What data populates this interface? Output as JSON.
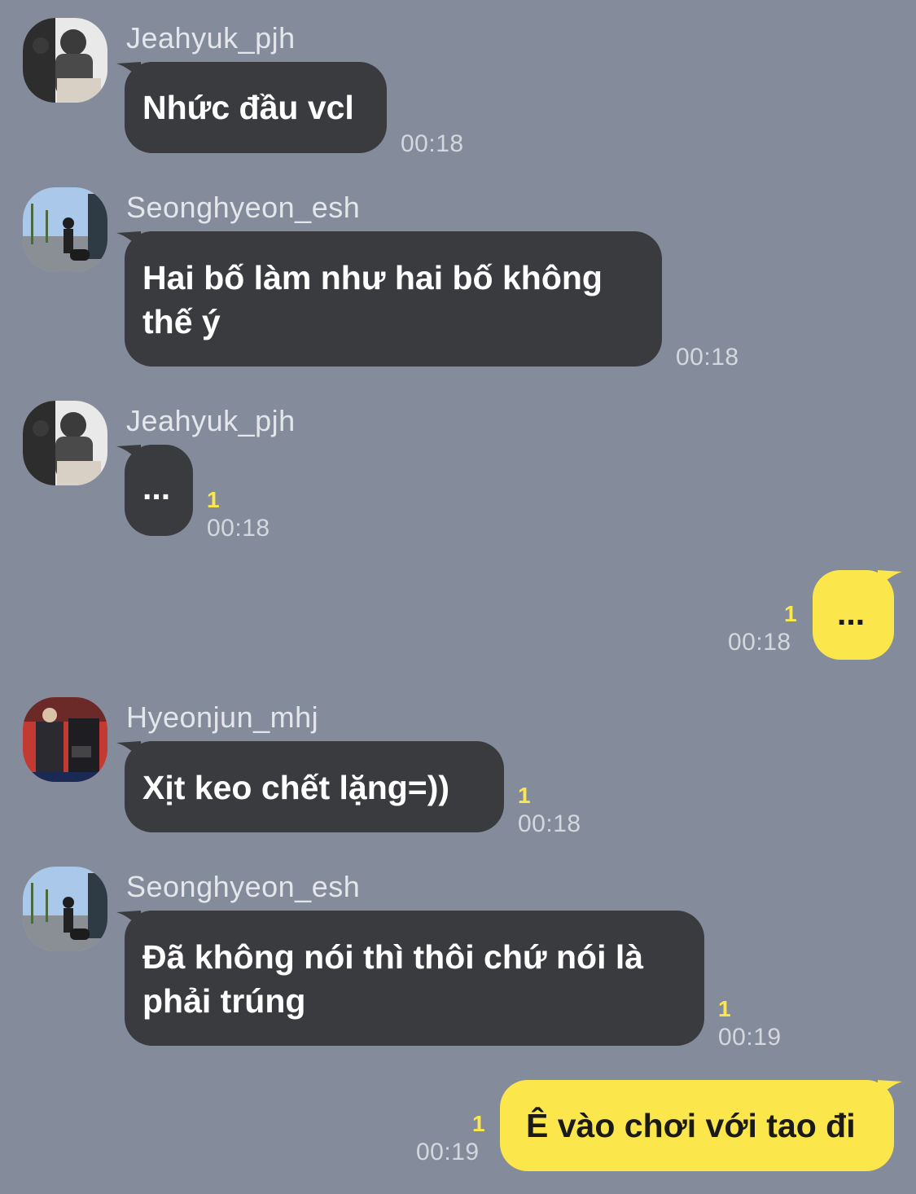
{
  "colors": {
    "background": "#848c9b",
    "incoming_bubble": "#3a3b3e",
    "outgoing_bubble": "#fbe64b",
    "unread_badge": "#fbe64b"
  },
  "messages": [
    {
      "sender": "Jeahyuk_pjh",
      "lines": [
        "Nhức đầu vcl"
      ],
      "time": "00:18",
      "unread": ""
    },
    {
      "sender": "Seonghyeon_esh",
      "lines": [
        "Hai bố làm như hai bố không",
        "thế ý"
      ],
      "time": "00:18",
      "unread": ""
    },
    {
      "sender": "Jeahyuk_pjh",
      "lines": [
        "..."
      ],
      "time": "00:18",
      "unread": "1"
    },
    {
      "sender": "",
      "lines": [
        "..."
      ],
      "time": "00:18",
      "unread": "1",
      "outgoing": true
    },
    {
      "sender": "Hyeonjun_mhj",
      "lines": [
        "Xịt keo chết lặng=))"
      ],
      "time": "00:18",
      "unread": "1"
    },
    {
      "sender": "Seonghyeon_esh",
      "lines": [
        "Đã không nói thì thôi chứ nói là",
        "phải trúng"
      ],
      "time": "00:19",
      "unread": "1"
    },
    {
      "sender": "",
      "lines": [
        "Ê vào chơi với tao đi"
      ],
      "time": "00:19",
      "unread": "1",
      "outgoing": true
    }
  ]
}
